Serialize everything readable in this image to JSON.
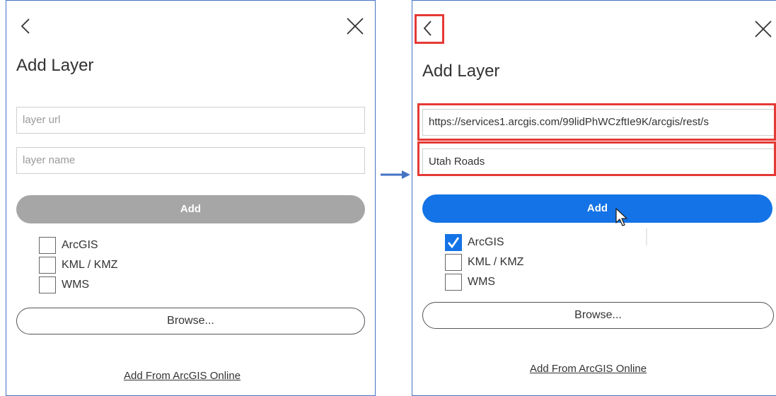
{
  "left": {
    "title": "Add Layer",
    "url_placeholder": "layer url",
    "name_placeholder": "layer name",
    "add_label": "Add",
    "options": [
      "ArcGIS",
      "KML / KMZ",
      "WMS"
    ],
    "browse_label": "Browse...",
    "online_link": "Add From ArcGIS Online"
  },
  "right": {
    "title": "Add Layer",
    "url_value": "https://services1.arcgis.com/99lidPhWCzftIe9K/arcgis/rest/s",
    "name_value": "Utah Roads",
    "add_label": "Add",
    "options": [
      "ArcGIS",
      "KML / KMZ",
      "WMS"
    ],
    "checked_option": "ArcGIS",
    "browse_label": "Browse...",
    "online_link": "Add From ArcGIS Online"
  },
  "colors": {
    "add_disabled": "#a6a6a6",
    "add_active": "#1473e6",
    "highlight": "#e53935",
    "arrow": "#4472c4",
    "panel_border": "#4472c4"
  },
  "icons": [
    "back-chevron-icon",
    "close-icon",
    "check-icon",
    "mouse-cursor-icon",
    "right-arrow-icon"
  ]
}
